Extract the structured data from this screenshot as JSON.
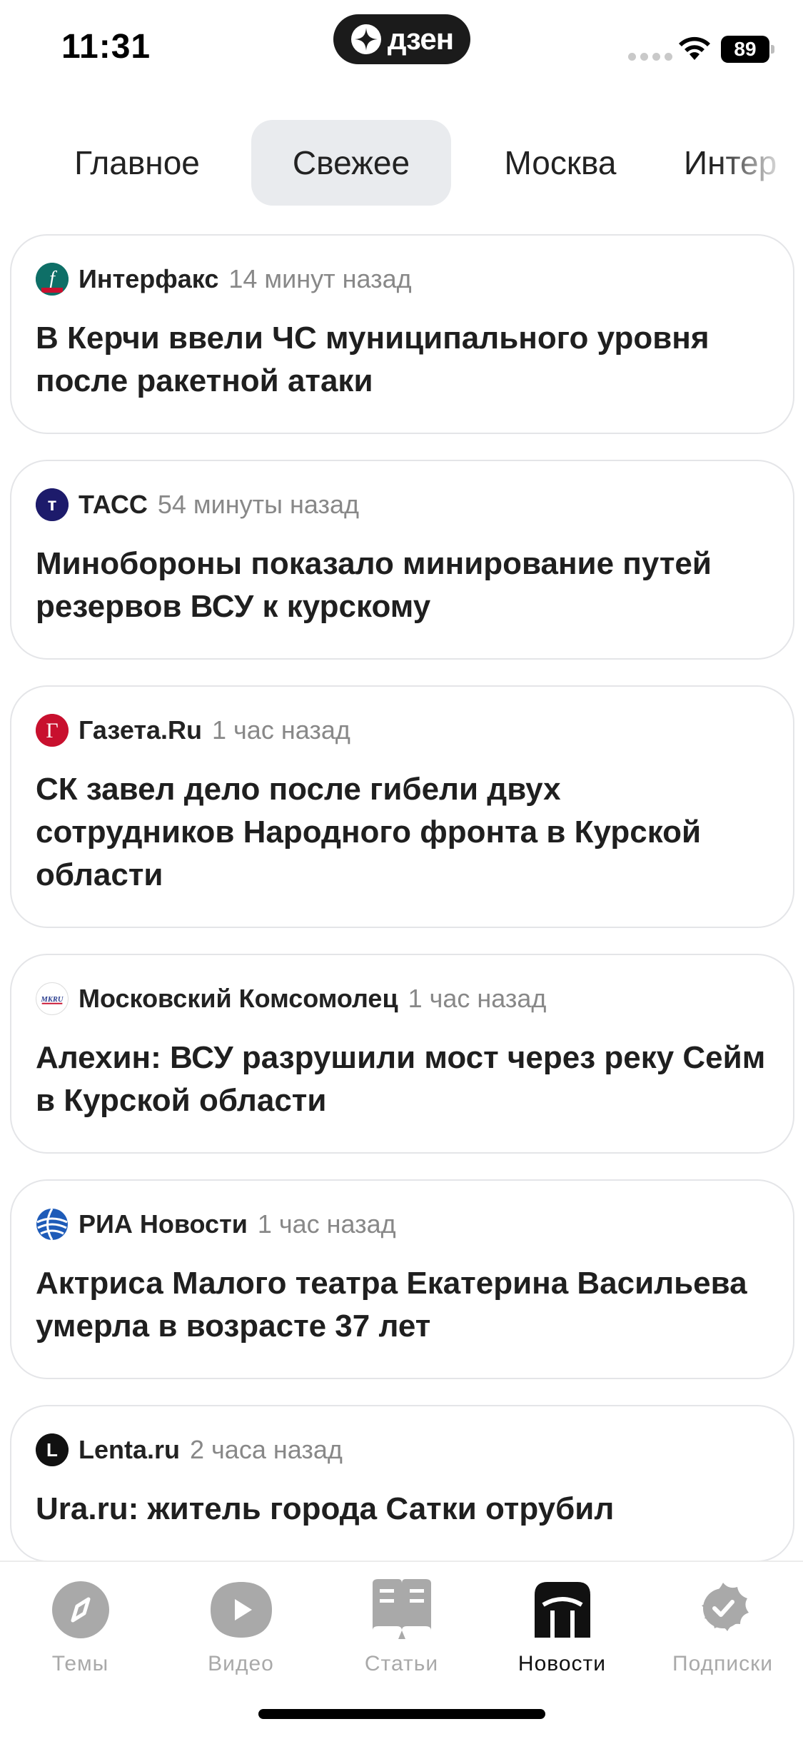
{
  "status_bar": {
    "time": "11:31",
    "app_badge": "дзен",
    "battery": "89"
  },
  "tabs": [
    {
      "label": "Главное",
      "active": false
    },
    {
      "label": "Свежее",
      "active": true
    },
    {
      "label": "Москва",
      "active": false
    },
    {
      "label": "Интер",
      "active": false
    }
  ],
  "feed": [
    {
      "source": "Интерфакс",
      "time": "14 минут назад",
      "logo": "interfax-logo",
      "title": "В Керчи ввели ЧС муниципального уровня после ракетной атаки"
    },
    {
      "source": "ТАСС",
      "time": "54 минуты назад",
      "logo": "tass-logo",
      "title": "Минобороны показало минирование путей резервов ВСУ к курскому"
    },
    {
      "source": "Газета.Ru",
      "time": "1 час назад",
      "logo": "gazeta-logo",
      "title": "СК завел дело после гибели двух сотрудников Народного фронта в Курской области"
    },
    {
      "source": "Московский Комсомолец",
      "time": "1 час назад",
      "logo": "mk-logo",
      "title": "Алехин: ВСУ разрушили мост через реку Сейм в Курской области"
    },
    {
      "source": "РИА Новости",
      "time": "1 час назад",
      "logo": "ria-logo",
      "title": "Актриса Малого театра Екатерина Васильева умерла в возрасте 37 лет"
    },
    {
      "source": "Lenta.ru",
      "time": "2 часа назад",
      "logo": "lenta-logo",
      "title": "Ura.ru: житель города Сатки отрубил"
    }
  ],
  "logo_text": {
    "interfax": "f",
    "tass": "т",
    "gazeta": "Г",
    "mk": "MKRU",
    "lenta": "L"
  },
  "bottom_nav": [
    {
      "label": "Темы",
      "icon": "compass-icon",
      "active": false
    },
    {
      "label": "Видео",
      "icon": "play-icon",
      "active": false
    },
    {
      "label": "Статьи",
      "icon": "book-icon",
      "active": false
    },
    {
      "label": "Новости",
      "icon": "news-icon",
      "active": true
    },
    {
      "label": "Подписки",
      "icon": "subscriptions-icon",
      "active": false
    }
  ],
  "colors": {
    "active_tab_bg": "#e9ebee",
    "card_border": "#e4e5e8",
    "muted_text": "#888888",
    "nav_inactive": "#a9a9a9"
  }
}
